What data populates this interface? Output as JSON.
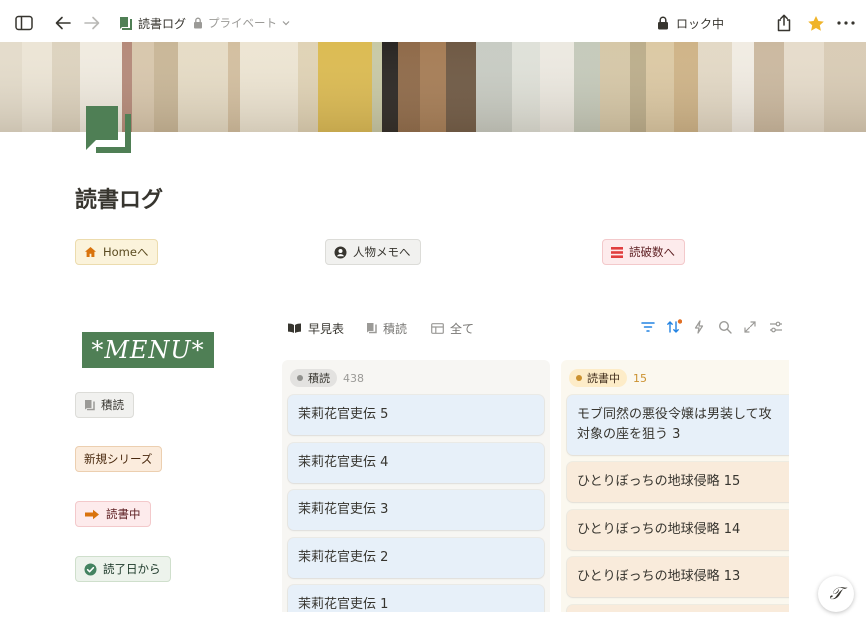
{
  "topbar": {
    "page_name": "読書ログ",
    "privacy": "プライベート",
    "lock_label": "ロック中"
  },
  "page": {
    "title": "読書ログ"
  },
  "links": [
    {
      "label": "Homeへ",
      "icon": "house-icon",
      "bg": "#fbf3db",
      "border": "#ecdcae",
      "color": "#5a4a1f"
    },
    {
      "label": "人物メモへ",
      "icon": "person-icon",
      "bg": "#f1f1ef",
      "border": "#dcdcd8",
      "color": "#37352f"
    },
    {
      "label": "読破数へ",
      "icon": "list-icon",
      "bg": "#fdebec",
      "border": "#f3c9cb",
      "color": "#5d1f22"
    }
  ],
  "menu": {
    "logo_text": "*MENU*",
    "items": [
      {
        "label": "積読",
        "icon": "book-icon",
        "bg": "#f1f1ef",
        "border": "#dcdcd8",
        "color": "#37352f"
      },
      {
        "label": "新規シリーズ",
        "icon": "",
        "bg": "#fbecdd",
        "border": "#eccfb0",
        "color": "#49290e"
      },
      {
        "label": "読書中",
        "icon": "arrow-right-icon",
        "bg": "#fdebec",
        "border": "#f3c9cb",
        "color": "#5d1f22"
      },
      {
        "label": "読了日から",
        "icon": "check-circle-icon",
        "bg": "#edf3ec",
        "border": "#cfdfcc",
        "color": "#1c3829"
      }
    ]
  },
  "views": [
    {
      "label": "早見表",
      "icon": "open-book-icon",
      "active": true
    },
    {
      "label": "積読",
      "icon": "book-icon",
      "active": false
    },
    {
      "label": "全て",
      "icon": "table-icon",
      "active": false
    }
  ],
  "board": {
    "columns": [
      {
        "name": "積読",
        "count": "438",
        "bg": "#f7f6f3",
        "pill_bg": "#e3e2e0",
        "pill_color": "#37352f",
        "dot": "#91918e",
        "count_color": "#9b9a97",
        "card_bg": "#e7f0f9",
        "cards": [
          {
            "title": "茉莉花官吏伝 5"
          },
          {
            "title": "茉莉花官吏伝 4"
          },
          {
            "title": "茉莉花官吏伝 3"
          },
          {
            "title": "茉莉花官吏伝 2"
          },
          {
            "title": "茉莉花官吏伝 1"
          }
        ]
      },
      {
        "name": "読書中",
        "count": "15",
        "bg": "#fbf8ef",
        "pill_bg": "#fdecc8",
        "pill_color": "#402c1b",
        "dot": "#cb912f",
        "count_color": "#cb912f",
        "cards": [
          {
            "title": "モブ同然の悪役令嬢は男装して攻",
            "title2": "対象の座を狙う 3",
            "bg": "#e7f0f9"
          },
          {
            "title": "ひとりぼっちの地球侵略 15",
            "bg": "#f9ebdb"
          },
          {
            "title": "ひとりぼっちの地球侵略 14",
            "bg": "#f9ebdb"
          },
          {
            "title": "ひとりぼっちの地球侵略 13",
            "bg": "#f9ebdb"
          },
          {
            "title": "",
            "bg": "#f9ebdb"
          }
        ]
      }
    ]
  },
  "colors": {
    "accent_blue": "#2383e2",
    "notif_orange": "#e16f24",
    "star": "#f0b429",
    "icon_green": "#4f7f55"
  }
}
